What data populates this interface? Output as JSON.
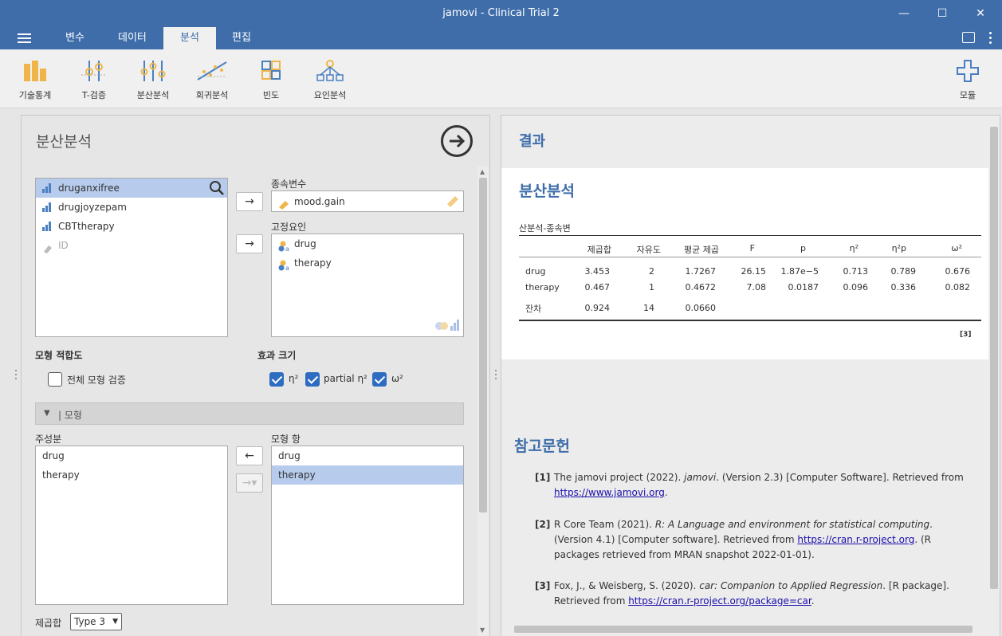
{
  "window": {
    "title": "jamovi - Clinical Trial 2",
    "minimize": "—",
    "maximize": "☐",
    "close": "✕"
  },
  "menu": {
    "tabs": [
      {
        "label": "변수"
      },
      {
        "label": "데이터"
      },
      {
        "label": "분석"
      },
      {
        "label": "편집"
      }
    ],
    "active_tab": "분석"
  },
  "ribbon": {
    "buttons": [
      {
        "label": "기술통계",
        "icon": "bar-chart-icon"
      },
      {
        "label": "T-검증",
        "icon": "t-test-icon"
      },
      {
        "label": "분산분석",
        "icon": "anova-icon"
      },
      {
        "label": "회귀분석",
        "icon": "regression-icon"
      },
      {
        "label": "빈도",
        "icon": "frequencies-icon"
      },
      {
        "label": "요인분석",
        "icon": "factor-icon"
      }
    ],
    "modules_label": "모듈"
  },
  "analysis": {
    "title": "분산분석",
    "variables": [
      {
        "name": "druganxifree",
        "type": "continuous",
        "selected": true
      },
      {
        "name": "drugjoyzepam",
        "type": "continuous",
        "selected": false
      },
      {
        "name": "CBTtherapy",
        "type": "continuous",
        "selected": false
      },
      {
        "name": "ID",
        "type": "id",
        "selected": false
      }
    ],
    "dependent_label": "종속변수",
    "dependent_value": "mood.gain",
    "factors_label": "고정요인",
    "factors": [
      {
        "name": "drug"
      },
      {
        "name": "therapy"
      }
    ],
    "model_fit_label": "모형 적합도",
    "overall_test_label": "전체 모형 검증",
    "effect_size_label": "효과 크기",
    "eta_label": "η²",
    "partial_eta_label": "partial η²",
    "omega_label": "ω²",
    "model_section_label": "| 모형",
    "components_label": "주성분",
    "components": [
      {
        "name": "drug"
      },
      {
        "name": "therapy"
      }
    ],
    "terms_label": "모형 항",
    "terms": [
      {
        "name": "drug",
        "selected": false
      },
      {
        "name": "therapy",
        "selected": true
      }
    ],
    "ss_label": "제곱합",
    "ss_value": "Type 3"
  },
  "results": {
    "header": "결과",
    "title": "분산분석",
    "table_caption": "산분석-종속변",
    "columns": [
      "제곱합",
      "자유도",
      "평균 제곱",
      "F",
      "p",
      "η²",
      "η²p",
      "ω²"
    ],
    "rows": [
      {
        "name": "drug",
        "ss": "3.453",
        "df": "2",
        "ms": "1.7267",
        "f": "26.15",
        "p": "1.87e−5",
        "eta": "0.713",
        "peta": "0.789",
        "omega": "0.676"
      },
      {
        "name": "therapy",
        "ss": "0.467",
        "df": "1",
        "ms": "0.4672",
        "f": "7.08",
        "p": "0.0187",
        "eta": "0.096",
        "peta": "0.336",
        "omega": "0.082"
      },
      {
        "name": "잔차",
        "ss": "0.924",
        "df": "14",
        "ms": "0.0660",
        "f": "",
        "p": "",
        "eta": "",
        "peta": "",
        "omega": ""
      }
    ],
    "note": "[3]"
  },
  "references": {
    "title": "참고문헌",
    "items": [
      {
        "num": "[1]",
        "pre": "The jamovi project (2022). ",
        "italic": "jamovi",
        "post": ". (Version 2.3) [Computer Software]. Retrieved from ",
        "link": "https://www.jamovi.org",
        "tail": "."
      },
      {
        "num": "[2]",
        "pre": "R Core Team (2021). ",
        "italic": "R: A Language and environment for statistical computing",
        "post": ". (Version 4.1) [Computer software]. Retrieved from ",
        "link": "https://cran.r-project.org",
        "tail": ". (R packages retrieved from MRAN snapshot 2022-01-01)."
      },
      {
        "num": "[3]",
        "pre": "Fox, J., & Weisberg, S. (2020). ",
        "italic": "car: Companion to Applied Regression",
        "post": ". [R package]. Retrieved from ",
        "link": "https://cran.r-project.org/package=car",
        "tail": "."
      }
    ]
  },
  "colors": {
    "accent": "#3e6da9",
    "selection": "#b7cbec",
    "checkbox": "#2d6cc0"
  }
}
